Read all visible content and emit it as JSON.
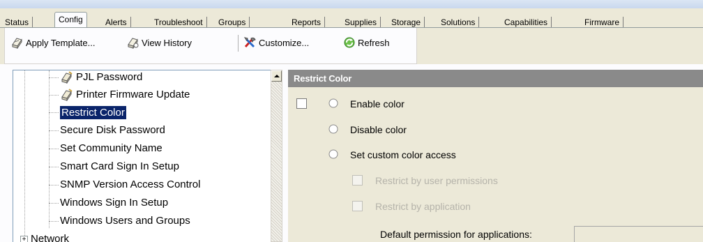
{
  "tabs": [
    {
      "label": "Status",
      "active": false
    },
    {
      "label": "Config",
      "active": true
    },
    {
      "label": "Alerts",
      "active": false
    },
    {
      "label": "Troubleshoot",
      "active": false
    },
    {
      "label": "Groups",
      "active": false
    },
    {
      "label": "Reports",
      "active": false
    },
    {
      "label": "Supplies",
      "active": false
    },
    {
      "label": "Storage",
      "active": false
    },
    {
      "label": "Solutions",
      "active": false
    },
    {
      "label": "Capabilities",
      "active": false
    },
    {
      "label": "Firmware",
      "active": false
    }
  ],
  "toolbar": {
    "apply_template": {
      "label": "Apply Template...",
      "icon": "printer-template-icon"
    },
    "view_history": {
      "label": "View History",
      "icon": "printer-history-icon"
    },
    "customize": {
      "label": "Customize...",
      "icon": "tools-icon"
    },
    "refresh": {
      "label": "Refresh",
      "icon": "refresh-icon"
    }
  },
  "tree": {
    "items": [
      {
        "label": "PJL Password",
        "icon": "printer-config-icon",
        "selected": false
      },
      {
        "label": "Printer Firmware Update",
        "icon": "printer-config-icon",
        "selected": false
      },
      {
        "label": "Restrict Color",
        "selected": true
      },
      {
        "label": "Secure Disk Password",
        "selected": false
      },
      {
        "label": "Set Community Name",
        "selected": false
      },
      {
        "label": "Smart Card Sign In Setup",
        "selected": false
      },
      {
        "label": "SNMP Version Access Control",
        "selected": false
      },
      {
        "label": "Windows Sign In Setup",
        "selected": false
      },
      {
        "label": "Windows Users and Groups",
        "selected": false
      },
      {
        "label": "Network",
        "expander": "+",
        "selected": false
      }
    ]
  },
  "panel": {
    "title": "Restrict Color",
    "enable_checked": false,
    "options": [
      {
        "label": "Enable color",
        "selected": false
      },
      {
        "label": "Disable color",
        "selected": false
      },
      {
        "label": "Set custom color access",
        "selected": false
      }
    ],
    "sub_options": [
      {
        "label": "Restrict by user permissions",
        "checked": false,
        "enabled": false
      },
      {
        "label": "Restrict by application",
        "checked": false,
        "enabled": false
      }
    ],
    "default_permission_label": "Default permission for applications:",
    "default_permission_value": ""
  },
  "colors": {
    "selection": "#0a246a",
    "panel_header": "#8a8a8a",
    "window_bg": "#ece9d8",
    "disabled_text": "#b5b3aa"
  }
}
